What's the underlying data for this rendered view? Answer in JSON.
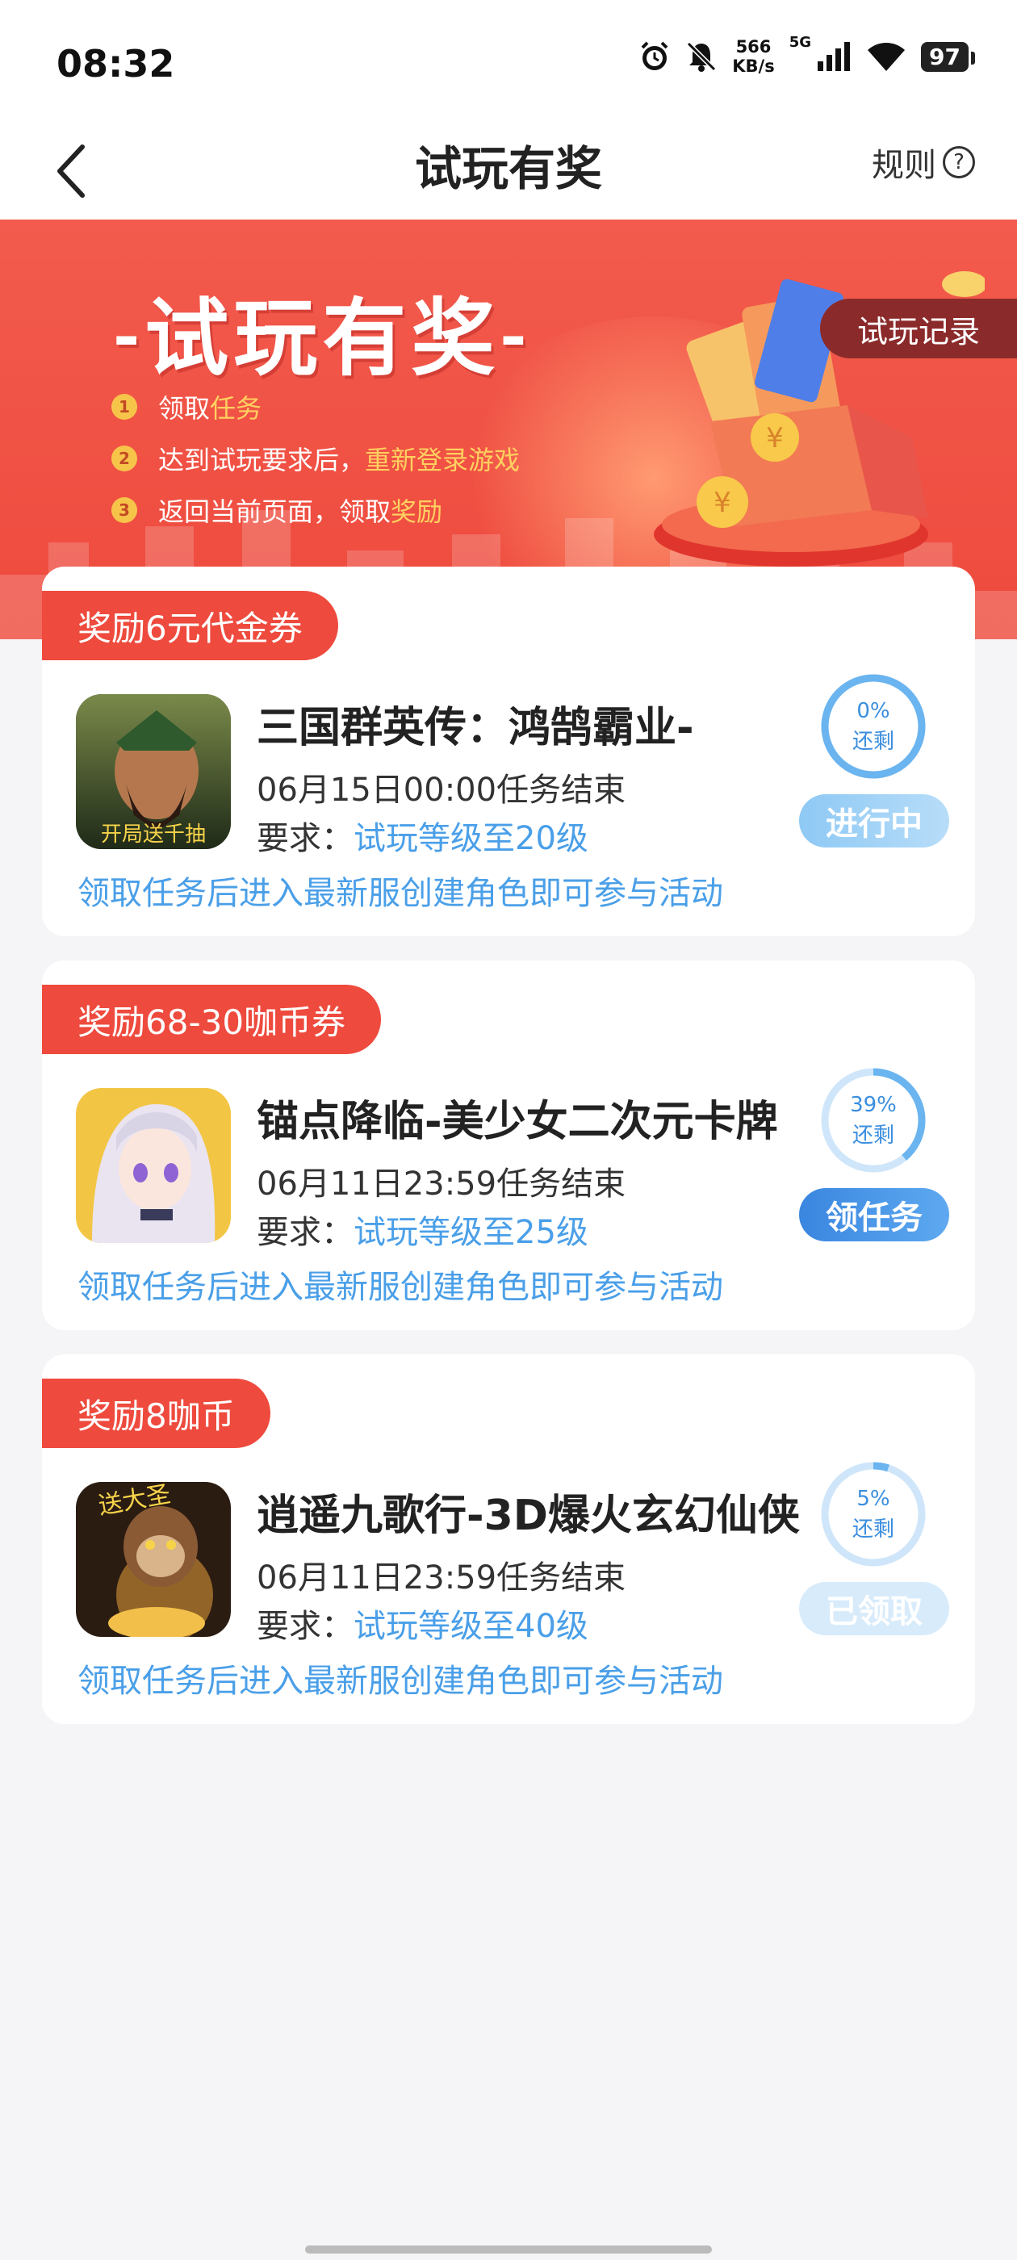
{
  "status_bar": {
    "time": "08:32",
    "net_speed_value": "566",
    "net_speed_unit": "KB/s",
    "network_type": "5G",
    "battery": "97",
    "icons": [
      "alarm-icon",
      "bell-off-icon",
      "signal-icon",
      "wifi-icon",
      "battery-icon"
    ]
  },
  "header": {
    "title": "试玩有奖",
    "rules_label": "规则",
    "back_icon": "chevron-left-icon",
    "help_icon": "question-circle-icon"
  },
  "banner": {
    "title": "试玩有奖",
    "record_button": "试玩记录",
    "steps": [
      {
        "num": "1",
        "text": "领取",
        "highlight": "任务"
      },
      {
        "num": "2",
        "text": "达到试玩要求后，",
        "highlight": "重新登录游戏"
      },
      {
        "num": "3",
        "text": "返回当前页面，领取",
        "highlight": "奖励"
      }
    ]
  },
  "tasks": [
    {
      "reward": "奖励6元代金券",
      "title": "三国群英传：鸿鹄霸业-",
      "deadline": "06月15日00:00任务结束",
      "require_label": "要求：",
      "require_value": "试玩等级至20级",
      "note": "领取任务后进入最新服创建角色即可参与活动",
      "percent_label": "0%",
      "remaining_label": "还剩",
      "remaining_fraction": 1.0,
      "action": "进行中",
      "icon_text": "开局送千抽"
    },
    {
      "reward": "奖励68-30咖币券",
      "title": "锚点降临-美少女二次元卡牌",
      "deadline": "06月11日23:59任务结束",
      "require_label": "要求：",
      "require_value": "试玩等级至25级",
      "note": "领取任务后进入最新服创建角色即可参与活动",
      "percent_label": "39%",
      "remaining_label": "还剩",
      "remaining_fraction": 0.39,
      "action": "领任务",
      "icon_text": ""
    },
    {
      "reward": "奖励8咖币",
      "title": "逍遥九歌行-3D爆火玄幻仙侠",
      "deadline": "06月11日23:59任务结束",
      "require_label": "要求：",
      "require_value": "试玩等级至40级",
      "note": "领取任务后进入最新服创建角色即可参与活动",
      "percent_label": "5%",
      "remaining_label": "还剩",
      "remaining_fraction": 0.05,
      "action": "已领取",
      "icon_text": "送大圣"
    }
  ],
  "colors": {
    "accent_red": "#ee4a3d",
    "accent_blue": "#4a9fe8",
    "highlight_yellow": "#ffd060"
  }
}
